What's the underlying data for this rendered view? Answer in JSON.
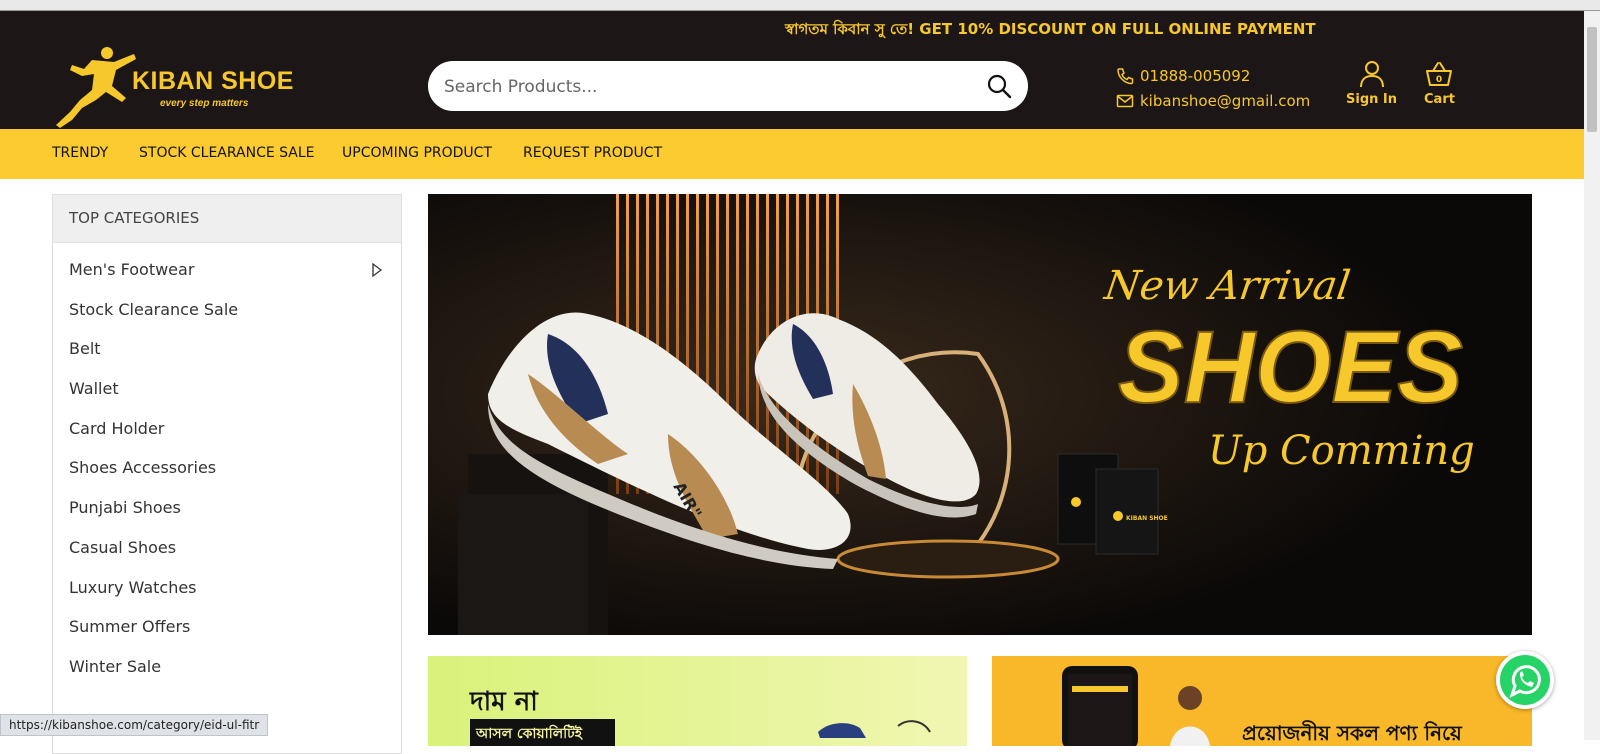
{
  "announcement": "স্বাগতম কিবান সু তে! GET 10% DISCOUNT ON FULL ONLINE PAYMENT",
  "brand": {
    "name": "KIBAN SHOE",
    "tagline": "every step matters"
  },
  "search": {
    "placeholder": "Search Products..."
  },
  "contact": {
    "phone": "01888-005092",
    "email": "kibanshoe@gmail.com"
  },
  "account": {
    "signin_label": "Sign In",
    "cart_label": "Cart",
    "cart_count": "0"
  },
  "nav": [
    {
      "label": "TRENDY"
    },
    {
      "label": "STOCK CLEARANCE SALE"
    },
    {
      "label": "UPCOMING PRODUCT"
    },
    {
      "label": "REQUEST PRODUCT"
    }
  ],
  "sidebar": {
    "title": "TOP CATEGORIES",
    "items": [
      {
        "label": "Men's Footwear"
      },
      {
        "label": "Stock Clearance Sale"
      },
      {
        "label": "Belt"
      },
      {
        "label": "Wallet"
      },
      {
        "label": "Card Holder"
      },
      {
        "label": "Shoes Accessories"
      },
      {
        "label": "Punjabi Shoes"
      },
      {
        "label": "Casual Shoes"
      },
      {
        "label": "Luxury Watches"
      },
      {
        "label": "Summer Offers"
      },
      {
        "label": "Winter Sale"
      }
    ]
  },
  "banner": {
    "line1": "New Arrival",
    "line2": "SHOES",
    "line3": "Up Comming",
    "shoe_label": "AIR\"",
    "bag_label": "KIBAN SHOE"
  },
  "promo1": {
    "text1": "দাম না",
    "text2": "আসল কোয়ালিটিই"
  },
  "promo2": {
    "text": "প্রয়োজনীয় সকল পণ্য নিয়ে"
  },
  "status_url": "https://kibanshoe.com/category/eid-ul-fitr",
  "colors": {
    "header_bg": "#1c1616",
    "accent": "#f7c82c",
    "navbar_bg": "#fccb30"
  }
}
